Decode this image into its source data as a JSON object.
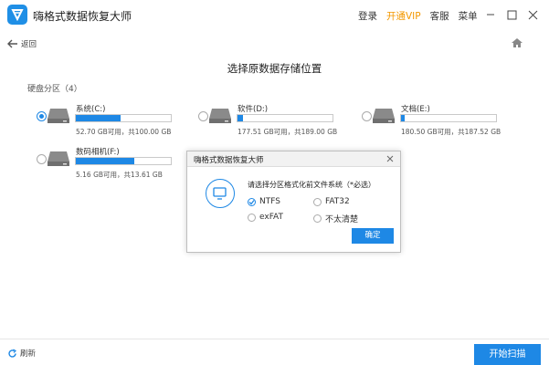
{
  "app": {
    "title": "嗨格式数据恢复大师"
  },
  "top_links": {
    "login": "登录",
    "vip": "开通VIP",
    "service": "客服",
    "menu": "菜单"
  },
  "nav": {
    "back_label": "返回"
  },
  "page": {
    "title": "选择原数据存储位置",
    "partition_label": "硬盘分区（4）"
  },
  "drives": [
    {
      "name": "系统(C:)",
      "info": "52.70 GB可用，共100.00 GB",
      "used_fraction": 0.47,
      "selected": true
    },
    {
      "name": "软件(D:)",
      "info": "177.51 GB可用，共189.00 GB",
      "used_fraction": 0.06,
      "selected": false
    },
    {
      "name": "文档(E:)",
      "info": "180.50 GB可用，共187.52 GB",
      "used_fraction": 0.04,
      "selected": false
    },
    {
      "name": "数码相机(F:)",
      "info": "5.16 GB可用，共13.61 GB",
      "used_fraction": 0.62,
      "selected": false
    }
  ],
  "dialog": {
    "title": "嗨格式数据恢复大师",
    "message": "请选择分区格式化前文件系统（*必选）",
    "options": [
      {
        "label": "NTFS",
        "checked": true
      },
      {
        "label": "FAT32",
        "checked": false
      },
      {
        "label": "exFAT",
        "checked": false
      },
      {
        "label": "不太清楚",
        "checked": false
      }
    ],
    "ok_label": "确定"
  },
  "footer": {
    "refresh_label": "刷新",
    "start_label": "开始扫描"
  },
  "colors": {
    "accent": "#1e88e5",
    "vip": "#f39800"
  }
}
